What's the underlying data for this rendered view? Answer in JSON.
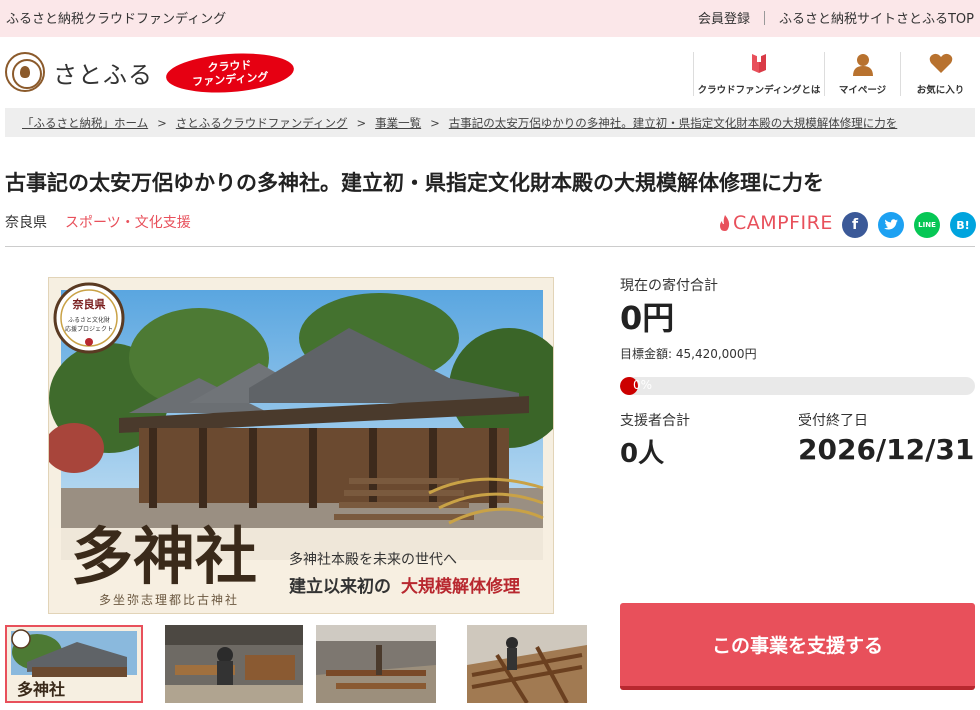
{
  "topbar": {
    "lead": "ふるさと納税クラウドファンディング",
    "links": [
      "会員登録",
      "ふるさと納税サイトさとふるTOP"
    ]
  },
  "header": {
    "logo_text": "さとふる",
    "badge_line1": "クラウド",
    "badge_line2": "ファンディング",
    "nav": [
      {
        "label": "クラウドファンディングとは",
        "icon": "book-icon"
      },
      {
        "label": "マイページ",
        "icon": "user-icon"
      },
      {
        "label": "お気に入り",
        "icon": "heart-icon"
      }
    ]
  },
  "breadcrumb": [
    "「ふるさと納税」ホーム",
    "さとふるクラウドファンディング",
    "事業一覧",
    "古事記の太安万侶ゆかりの多神社。建立初・県指定文化財本殿の大規模解体修理に力を"
  ],
  "breadcrumb_sep": ">",
  "project": {
    "title": "古事記の太安万侶ゆかりの多神社。建立初・県指定文化財本殿の大規模解体修理に力を",
    "prefecture": "奈良県",
    "category": "スポーツ・文化支援",
    "platform": "CAMPFIRE",
    "social": [
      {
        "name": "facebook-icon",
        "glyph": "f",
        "color": "#3b5998"
      },
      {
        "name": "twitter-icon",
        "glyph": "t",
        "color": "#1da1f2"
      },
      {
        "name": "line-icon",
        "glyph": "LINE",
        "color": "#06c755"
      },
      {
        "name": "hatena-bookmark-icon",
        "glyph": "B!",
        "color": "#00a4de"
      }
    ]
  },
  "hero": {
    "seal_pref": "奈良県",
    "seal_l1": "ふるさと文化財",
    "seal_l2": "応援プロジェクト",
    "big_title": "多神社",
    "sub_title": "多坐弥志理都比古神社",
    "tag_line1": "多神社本殿を未来の世代へ",
    "tag_line2_a": "建立以来初の",
    "tag_line2_b": "大規模解体修理"
  },
  "stats": {
    "total_label": "現在の寄付合計",
    "total_value": "0円",
    "goal_text": "目標金額: 45,420,000円",
    "progress_text": "0%",
    "progress_fraction": 0,
    "supporters_label": "支援者合計",
    "supporters_value": "0人",
    "deadline_label": "受付終了日",
    "deadline_value": "2026/12/31"
  },
  "cta": {
    "label": "この事業を支援する"
  }
}
